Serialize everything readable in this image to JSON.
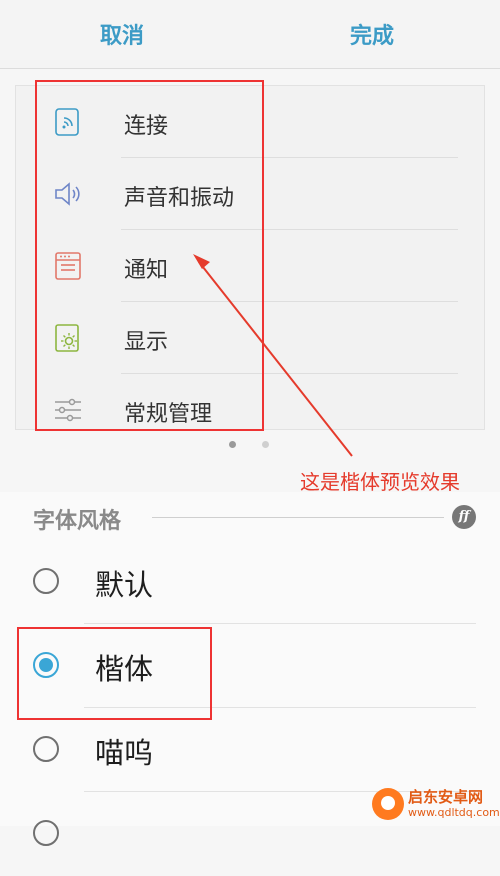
{
  "toolbar": {
    "cancel_label": "取消",
    "done_label": "完成",
    "accent": "#3c9bc6"
  },
  "preview": {
    "items": [
      {
        "label": "连接",
        "icon": "connection-icon"
      },
      {
        "label": "声音和振动",
        "icon": "speaker-icon"
      },
      {
        "label": "通知",
        "icon": "notification-icon"
      },
      {
        "label": "显示",
        "icon": "display-brightness-icon"
      },
      {
        "label": "常规管理",
        "icon": "sliders-icon"
      }
    ],
    "page_indicator": {
      "pages": 2,
      "current": 1
    }
  },
  "annotation": {
    "text": "这是楷体预览效果",
    "color": "#e53b2c"
  },
  "font_style": {
    "title": "字体风格",
    "icon": "font-ff-icon",
    "options": [
      {
        "label": "默认",
        "selected": false
      },
      {
        "label": "楷体",
        "selected": true
      },
      {
        "label": "喵呜",
        "selected": false
      }
    ]
  },
  "watermark": {
    "name": "启东安卓网",
    "url": "www.qdltdq.com"
  }
}
